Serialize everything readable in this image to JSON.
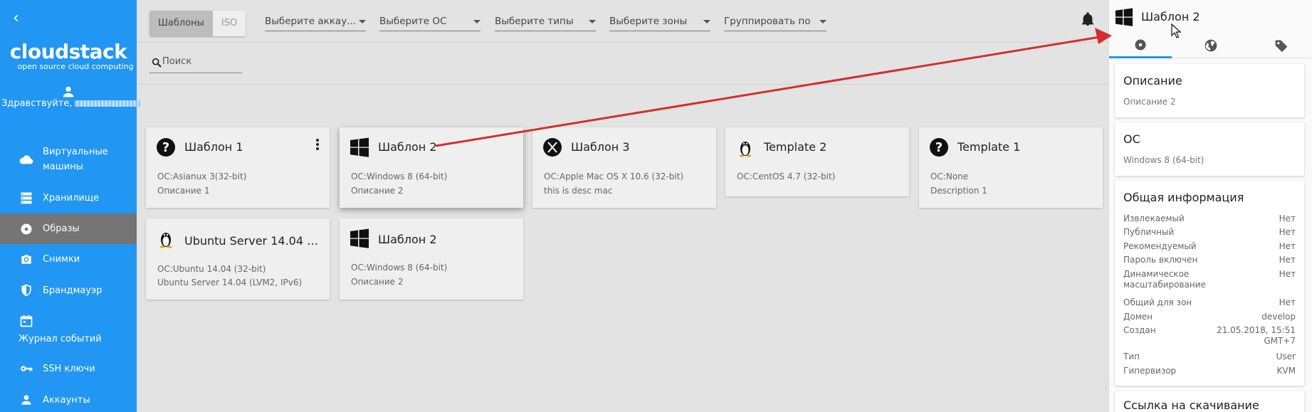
{
  "sidebar": {
    "logo_main": "cloudstack",
    "logo_sub": "open source cloud computing",
    "greeting": "Здравствуйте,",
    "items": [
      {
        "label": "Виртуальные машины",
        "icon": "cloud-icon"
      },
      {
        "label": "Хранилище",
        "icon": "storage-icon"
      },
      {
        "label": "Образы",
        "icon": "disc-icon",
        "active": true
      },
      {
        "label": "Снимки",
        "icon": "camera-icon"
      },
      {
        "label": "Брандмауэр",
        "icon": "shield-icon"
      },
      {
        "label": "Журнал событий",
        "icon": "calendar-icon"
      },
      {
        "label": "SSH ключи",
        "icon": "key-icon"
      },
      {
        "label": "Аккаунты",
        "icon": "person-icon"
      }
    ]
  },
  "toolbar": {
    "toggle": [
      "Шаблоны",
      "ISO"
    ],
    "filters": [
      "Выберите аккау...",
      "Выберите ОС",
      "Выберите типы",
      "Выберите зоны",
      "Группировать по"
    ]
  },
  "search": {
    "placeholder": "Поиск"
  },
  "cards": [
    {
      "title": "Шаблон 1",
      "os": "ОС:Asianux 3(32-bit)",
      "desc": "Описание 1",
      "icon": "question-icon"
    },
    {
      "title": "Шаблон 2",
      "os": "ОС:Windows 8 (64-bit)",
      "desc": "Описание 2",
      "icon": "windows-icon"
    },
    {
      "title": "Шаблон 3",
      "os": "ОС:Apple Mac OS X 10.6 (32-bit)",
      "desc": "this is desc mac",
      "icon": "macos-x-icon"
    },
    {
      "title": "Template 2",
      "os": "ОС:CentOS 4.7 (32-bit)",
      "desc": "",
      "icon": "linux-tux-icon"
    },
    {
      "title": "Template 1",
      "os": "ОС:None",
      "desc": "Description 1",
      "icon": "question-icon"
    },
    {
      "title": "Ubuntu Server 14.04 (...",
      "os": "ОС:Ubuntu 14.04 (32-bit)",
      "desc": "Ubuntu Server 14.04 (LVM2, IPv6)",
      "icon": "linux-tux-icon"
    },
    {
      "title": "Шаблон 2",
      "os": "ОС:Windows 8 (64-bit)",
      "desc": "Описание 2",
      "icon": "windows-icon"
    }
  ],
  "details": {
    "title": "Шаблон 2",
    "tabs": [
      "disc-icon",
      "globe-icon",
      "tag-icon"
    ],
    "description_label": "Описание",
    "description_value": "Описание 2",
    "os_label": "ОС",
    "os_value": "Windows 8 (64-bit)",
    "general_label": "Общая информация",
    "general": [
      {
        "key": "Извлекаемый",
        "value": "Нет"
      },
      {
        "key": "Публичный",
        "value": "Нет"
      },
      {
        "key": "Рекомендуемый",
        "value": "Нет"
      },
      {
        "key": "Пароль включен",
        "value": "Нет"
      },
      {
        "key": "Динамическое масштабирование",
        "value": "Нет"
      },
      {
        "key": "Общий для зон",
        "value": "Нет"
      },
      {
        "key": "Домен",
        "value": "develop"
      },
      {
        "key": "Создан",
        "value": "21.05.2018, 15:51 GMT+7"
      },
      {
        "key": "Тип",
        "value": "User"
      },
      {
        "key": "Гипервизор",
        "value": "KVM"
      }
    ],
    "download_label": "Ссылка на скачивание"
  },
  "colors": {
    "sidebar": "#2196f3",
    "active_nav": "#757575",
    "annotation_arrow": "#d32f2f"
  }
}
